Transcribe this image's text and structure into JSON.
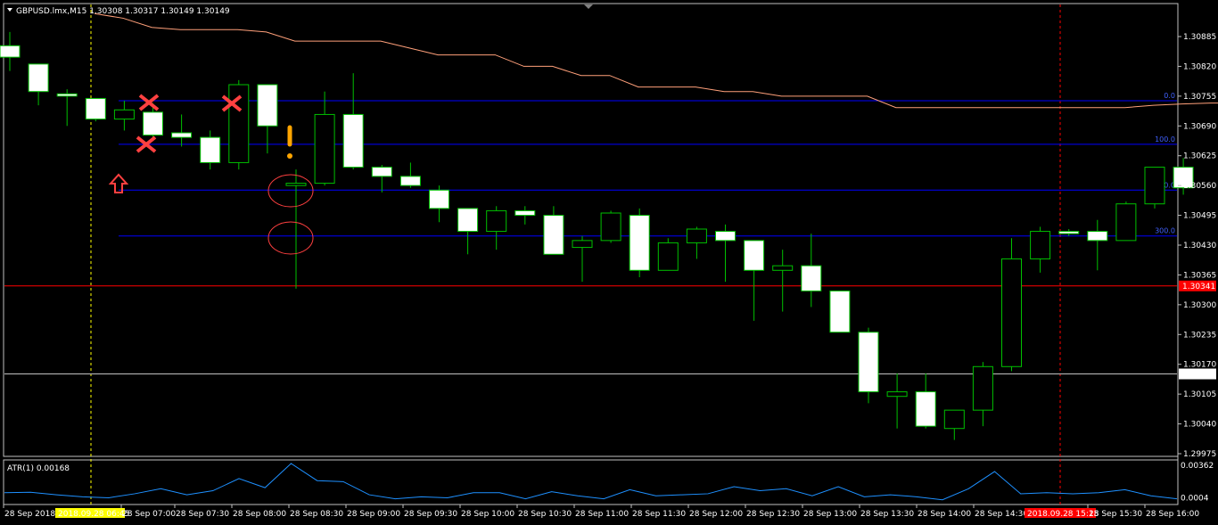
{
  "title": "GBPUSD.lmx,M15  1.30308 1.30317 1.30149 1.30149",
  "indicator_title": "ATR(1) 0.00168",
  "colors": {
    "background": "#000000",
    "grid_border": "#c0c0c0",
    "bull_candle": "#00c000",
    "bear_candle": "#ffffff",
    "fib_line": "#0000ff",
    "support_line": "#ff0000",
    "bid_line": "#c0c0c0",
    "ma_line": "#ffa07a",
    "atr_line": "#1e90ff",
    "marker_red": "#ff4040",
    "marker_orange": "#ffa500",
    "date_highlight": "#ffff00",
    "date_highlight_red": "#ff0000"
  },
  "chart_data": {
    "type": "candlestick",
    "symbol": "GBPUSD.lmx",
    "timeframe": "M15",
    "ylim": [
      1.29975,
      1.3092
    ],
    "yticks": [
      "1.30885",
      "1.30820",
      "1.30755",
      "1.30690",
      "1.30625",
      "1.30560",
      "1.30495",
      "1.30430",
      "1.30365",
      "1.30300",
      "1.30235",
      "1.30170",
      "1.30105",
      "1.30040",
      "1.29975"
    ],
    "xticks": [
      "28 Sep 2018",
      "2018.09.28 06:45",
      "28 Sep 07:00",
      "28 Sep 07:30",
      "28 Sep 08:00",
      "28 Sep 08:30",
      "28 Sep 09:00",
      "28 Sep 09:30",
      "28 Sep 10:00",
      "28 Sep 10:30",
      "28 Sep 11:00",
      "28 Sep 11:30",
      "28 Sep 12:00",
      "28 Sep 12:30",
      "28 Sep 13:00",
      "28 Sep 13:30",
      "28 Sep 14:00",
      "28 Sep 14:30",
      "2018.09.28 15:15",
      "28 Sep 15:30",
      "28 Sep 16:00"
    ],
    "candles": [
      {
        "o": 1.30865,
        "h": 1.30895,
        "l": 1.3081,
        "c": 1.3084
      },
      {
        "o": 1.30825,
        "h": 1.30825,
        "l": 1.30735,
        "c": 1.30765
      },
      {
        "o": 1.3076,
        "h": 1.3077,
        "l": 1.3069,
        "c": 1.30755
      },
      {
        "o": 1.3075,
        "h": 1.3075,
        "l": 1.307,
        "c": 1.30705
      },
      {
        "o": 1.30705,
        "h": 1.30745,
        "l": 1.3068,
        "c": 1.30725
      },
      {
        "o": 1.3072,
        "h": 1.3074,
        "l": 1.3066,
        "c": 1.3067
      },
      {
        "o": 1.30675,
        "h": 1.30715,
        "l": 1.30645,
        "c": 1.30665
      },
      {
        "o": 1.30665,
        "h": 1.3068,
        "l": 1.30595,
        "c": 1.3061
      },
      {
        "o": 1.3061,
        "h": 1.3079,
        "l": 1.30595,
        "c": 1.3078
      },
      {
        "o": 1.3078,
        "h": 1.3078,
        "l": 1.3063,
        "c": 1.3069
      },
      {
        "o": 1.3056,
        "h": 1.30595,
        "l": 1.30335,
        "c": 1.30565
      },
      {
        "o": 1.30565,
        "h": 1.30765,
        "l": 1.3056,
        "c": 1.30715
      },
      {
        "o": 1.30715,
        "h": 1.30805,
        "l": 1.30595,
        "c": 1.306
      },
      {
        "o": 1.306,
        "h": 1.30605,
        "l": 1.30545,
        "c": 1.3058
      },
      {
        "o": 1.3058,
        "h": 1.3061,
        "l": 1.30555,
        "c": 1.3056
      },
      {
        "o": 1.3055,
        "h": 1.3056,
        "l": 1.3048,
        "c": 1.3051
      },
      {
        "o": 1.3051,
        "h": 1.3051,
        "l": 1.3041,
        "c": 1.3046
      },
      {
        "o": 1.3046,
        "h": 1.30515,
        "l": 1.3042,
        "c": 1.30505
      },
      {
        "o": 1.30505,
        "h": 1.30515,
        "l": 1.30475,
        "c": 1.30495
      },
      {
        "o": 1.30495,
        "h": 1.30515,
        "l": 1.3041,
        "c": 1.3041
      },
      {
        "o": 1.30425,
        "h": 1.3045,
        "l": 1.3035,
        "c": 1.3044
      },
      {
        "o": 1.3044,
        "h": 1.30505,
        "l": 1.30435,
        "c": 1.305
      },
      {
        "o": 1.30495,
        "h": 1.3051,
        "l": 1.3036,
        "c": 1.30375
      },
      {
        "o": 1.30375,
        "h": 1.30445,
        "l": 1.30375,
        "c": 1.30435
      },
      {
        "o": 1.30435,
        "h": 1.3047,
        "l": 1.304,
        "c": 1.30465
      },
      {
        "o": 1.3046,
        "h": 1.30475,
        "l": 1.3035,
        "c": 1.3044
      },
      {
        "o": 1.3044,
        "h": 1.3044,
        "l": 1.30265,
        "c": 1.30375
      },
      {
        "o": 1.30375,
        "h": 1.3042,
        "l": 1.30285,
        "c": 1.30385
      },
      {
        "o": 1.30385,
        "h": 1.30455,
        "l": 1.30295,
        "c": 1.3033
      },
      {
        "o": 1.3033,
        "h": 1.3033,
        "l": 1.3024,
        "c": 1.3024
      },
      {
        "o": 1.3024,
        "h": 1.3025,
        "l": 1.30085,
        "c": 1.3011
      },
      {
        "o": 1.301,
        "h": 1.3015,
        "l": 1.3003,
        "c": 1.3011
      },
      {
        "o": 1.3011,
        "h": 1.3015,
        "l": 1.3003,
        "c": 1.30035
      },
      {
        "o": 1.3003,
        "h": 1.3007,
        "l": 1.30005,
        "c": 1.3007
      },
      {
        "o": 1.3007,
        "h": 1.30175,
        "l": 1.30035,
        "c": 1.30165
      },
      {
        "o": 1.30165,
        "h": 1.30445,
        "l": 1.30155,
        "c": 1.304
      },
      {
        "o": 1.304,
        "h": 1.3047,
        "l": 1.3037,
        "c": 1.3046
      },
      {
        "o": 1.3046,
        "h": 1.30465,
        "l": 1.3045,
        "c": 1.30455
      },
      {
        "o": 1.3046,
        "h": 1.30485,
        "l": 1.30375,
        "c": 1.3044
      },
      {
        "o": 1.3044,
        "h": 1.30525,
        "l": 1.3044,
        "c": 1.3052
      },
      {
        "o": 1.3052,
        "h": 1.306,
        "l": 1.3051,
        "c": 1.306
      },
      {
        "o": 1.306,
        "h": 1.3062,
        "l": 1.3054,
        "c": 1.30555
      }
    ],
    "ma_line": [
      1.30935,
      1.30925,
      1.30905,
      1.309,
      1.309,
      1.309,
      1.30895,
      1.30875,
      1.30875,
      1.30875,
      1.30875,
      1.3086,
      1.30845,
      1.30845,
      1.30845,
      1.3082,
      1.3082,
      1.308,
      1.308,
      1.30775,
      1.30775,
      1.30775,
      1.30765,
      1.30765,
      1.30755,
      1.30755,
      1.30755,
      1.30755,
      1.3073,
      1.3073,
      1.3073,
      1.3073,
      1.3073,
      1.3073,
      1.3073,
      1.3073,
      1.3073,
      1.30735,
      1.30738,
      1.3074,
      1.3074,
      1.3074
    ],
    "fib_levels": [
      {
        "label": "0.0",
        "value": 1.30745
      },
      {
        "label": "100.0",
        "value": 1.3065
      },
      {
        "label": "200.0",
        "value": 1.3055
      },
      {
        "label": "300.0",
        "value": 1.3045
      }
    ],
    "support_level": {
      "label": "1.30341",
      "value": 1.30341
    },
    "bid_level": {
      "label": "1.30149",
      "value": 1.30149
    },
    "atr": {
      "ylim": [
        0.0,
        0.00362
      ],
      "yticks": [
        "0.00362",
        "0.0004"
      ],
      "values": [
        0.0009,
        0.00095,
        0.0007,
        0.0005,
        0.0004,
        0.0008,
        0.0013,
        0.0007,
        0.0011,
        0.0023,
        0.0014,
        0.0038,
        0.0021,
        0.002,
        0.0007,
        0.0003,
        0.0005,
        0.0004,
        0.0009,
        0.0009,
        0.0003,
        0.001,
        0.0006,
        0.0003,
        0.0012,
        0.0006,
        0.0007,
        0.0008,
        0.0015,
        0.0011,
        0.0013,
        0.0006,
        0.0015,
        0.0005,
        0.0007,
        0.0005,
        0.0002,
        0.0013,
        0.003,
        0.0008,
        0.0009,
        0.0008,
        0.0009,
        0.0012,
        0.0006,
        0.0003
      ]
    }
  }
}
